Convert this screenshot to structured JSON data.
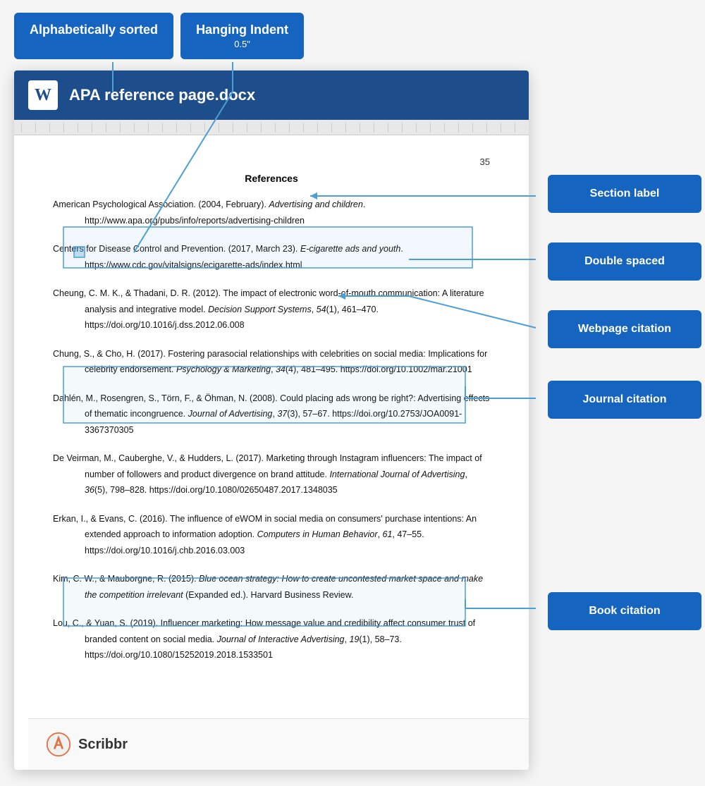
{
  "badges": {
    "alphabetically": "Alphabetically sorted",
    "hanging_indent": "Hanging Indent",
    "hanging_sub": "0.5\""
  },
  "document": {
    "title": "APA reference page.docx",
    "page_number": "35",
    "references_heading": "References",
    "entries": [
      {
        "id": 1,
        "text_parts": [
          {
            "text": "American Psychological Association. (2004, February). ",
            "italic": false
          },
          {
            "text": "Advertising and children",
            "italic": true
          },
          {
            "text": ". http://www.apa.org/pubs/info/reports/advertising-children",
            "italic": false
          }
        ]
      },
      {
        "id": 2,
        "text_parts": [
          {
            "text": "Centers for Disease Control and Prevention. (2017, March 23). ",
            "italic": false
          },
          {
            "text": "E-cigarette ads and youth",
            "italic": true
          },
          {
            "text": ". https://www.cdc.gov/vitalsigns/ecigarette-ads/index.html",
            "italic": false
          }
        ]
      },
      {
        "id": 3,
        "text_parts": [
          {
            "text": "Cheung, C. M. K., & Thadani, D. R. (2012). The impact of electronic word-of-mouth communication: A literature analysis and integrative model. ",
            "italic": false
          },
          {
            "text": "Decision Support Systems",
            "italic": true
          },
          {
            "text": ", ",
            "italic": false
          },
          {
            "text": "54",
            "italic": true
          },
          {
            "text": "(1), 461–470. https://doi.org/10.1016/j.dss.2012.06.008",
            "italic": false
          }
        ]
      },
      {
        "id": 4,
        "text_parts": [
          {
            "text": "Chung, S., & Cho, H. (2017). Fostering parasocial relationships with celebrities on social media: Implications for celebrity endorsement. ",
            "italic": false
          },
          {
            "text": "Psychology & Marketing",
            "italic": true
          },
          {
            "text": ", ",
            "italic": false
          },
          {
            "text": "34",
            "italic": true
          },
          {
            "text": "(4), 481–495. https://doi.org/10.1002/mar.21001",
            "italic": false
          }
        ]
      },
      {
        "id": 5,
        "text_parts": [
          {
            "text": "Dahlén, M., Rosengren, S., Törn, F., & Öhman, N. (2008). Could placing ads wrong be right?: Advertising effects of thematic incongruence. ",
            "italic": false
          },
          {
            "text": "Journal of Advertising",
            "italic": true
          },
          {
            "text": ", ",
            "italic": false
          },
          {
            "text": "37",
            "italic": true
          },
          {
            "text": "(3), 57–67. https://doi.org/10.2753/JOA0091-3367370305",
            "italic": false
          }
        ]
      },
      {
        "id": 6,
        "text_parts": [
          {
            "text": "De Veirman, M., Cauberghe, V., & Hudders, L. (2017). Marketing through Instagram influencers: The impact of number of followers and product divergence on brand attitude. ",
            "italic": false
          },
          {
            "text": "International Journal of Advertising",
            "italic": true
          },
          {
            "text": ", ",
            "italic": false
          },
          {
            "text": "36",
            "italic": true
          },
          {
            "text": "(5), 798–828. https://doi.org/10.1080/02650487.2017.1348035",
            "italic": false
          }
        ]
      },
      {
        "id": 7,
        "text_parts": [
          {
            "text": "Erkan, I., & Evans, C. (2016). The influence of eWOM in social media on consumers' purchase intentions: An extended approach to information adoption. ",
            "italic": false
          },
          {
            "text": "Computers in Human Behavior",
            "italic": true
          },
          {
            "text": ", ",
            "italic": false
          },
          {
            "text": "61",
            "italic": true
          },
          {
            "text": ", 47–55. https://doi.org/10.1016/j.chb.2016.03.003",
            "italic": false
          }
        ]
      },
      {
        "id": 8,
        "text_parts": [
          {
            "text": "Kim, C. W., & Mauborgne, R. (2015). ",
            "italic": false
          },
          {
            "text": "Blue ocean strategy: How to create uncontested market space and make the competition irrelevant",
            "italic": true
          },
          {
            "text": " (Expanded ed.). Harvard Business Review.",
            "italic": false
          }
        ]
      },
      {
        "id": 9,
        "text_parts": [
          {
            "text": "Lou, C., & Yuan, S. (2019). Influencer marketing: How message value and credibility affect consumer trust of branded content on social media. ",
            "italic": false
          },
          {
            "text": "Journal of Interactive Advertising",
            "italic": true
          },
          {
            "text": ", ",
            "italic": false
          },
          {
            "text": "19",
            "italic": true
          },
          {
            "text": "(1), 58–73. https://doi.org/10.1080/15252019.2018.1533501",
            "italic": false
          }
        ]
      }
    ]
  },
  "annotations": {
    "section_label": "Section label",
    "double_spaced": "Double spaced",
    "webpage_citation": "Webpage citation",
    "journal_citation": "Journal citation",
    "book_citation": "Book citation"
  },
  "footer": {
    "brand": "Scribbr"
  }
}
